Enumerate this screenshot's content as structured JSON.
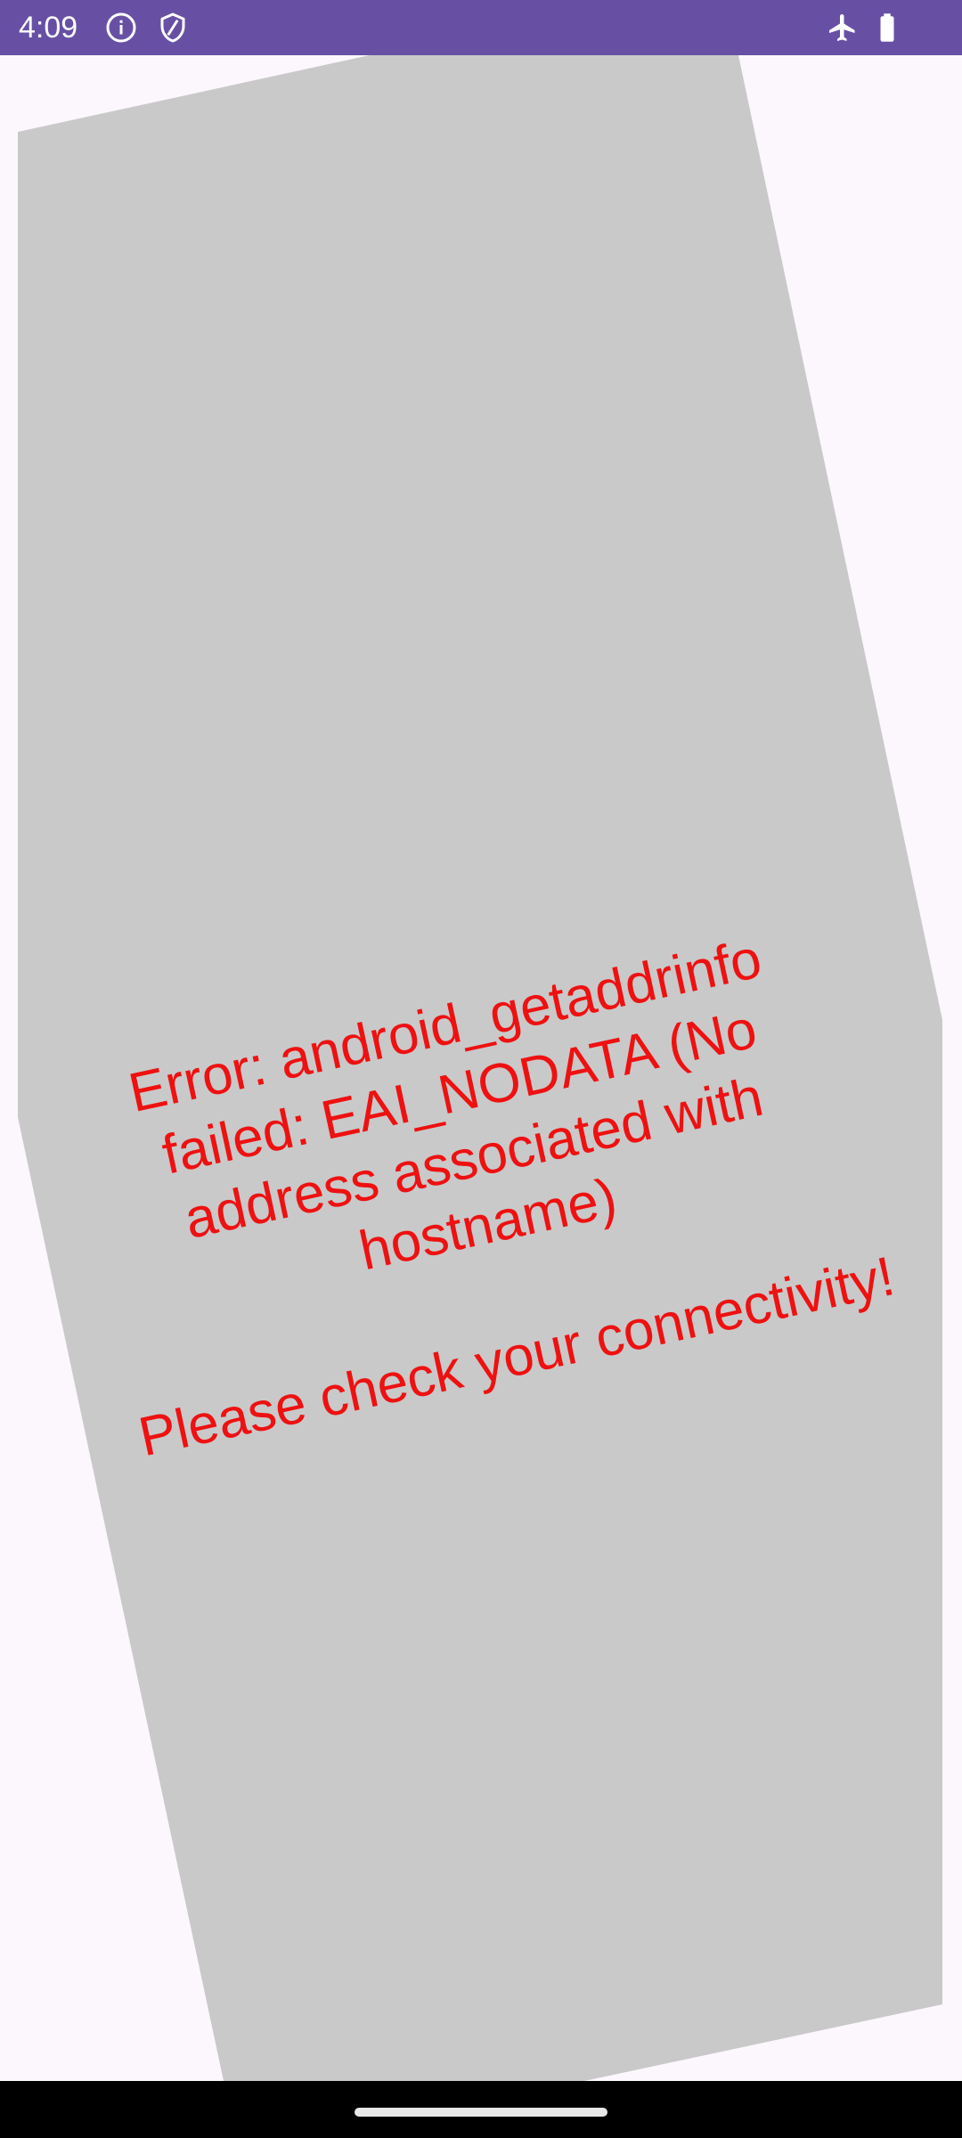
{
  "status_bar": {
    "time": "4:09",
    "background_color": "#6750a4",
    "icons_left": [
      "info-icon",
      "shield-icon"
    ],
    "icons_right": [
      "airplane-mode-icon",
      "battery-icon"
    ]
  },
  "error_view": {
    "message": "Error: android_getaddrinfo failed: EAI_NODATA (No address associated with hostname)",
    "hint": "Please check your connectivity!",
    "text_color": "#ee1111",
    "panel_color": "#c9c9c9"
  },
  "navigation_bar": {
    "handle": "gesture-handle"
  }
}
